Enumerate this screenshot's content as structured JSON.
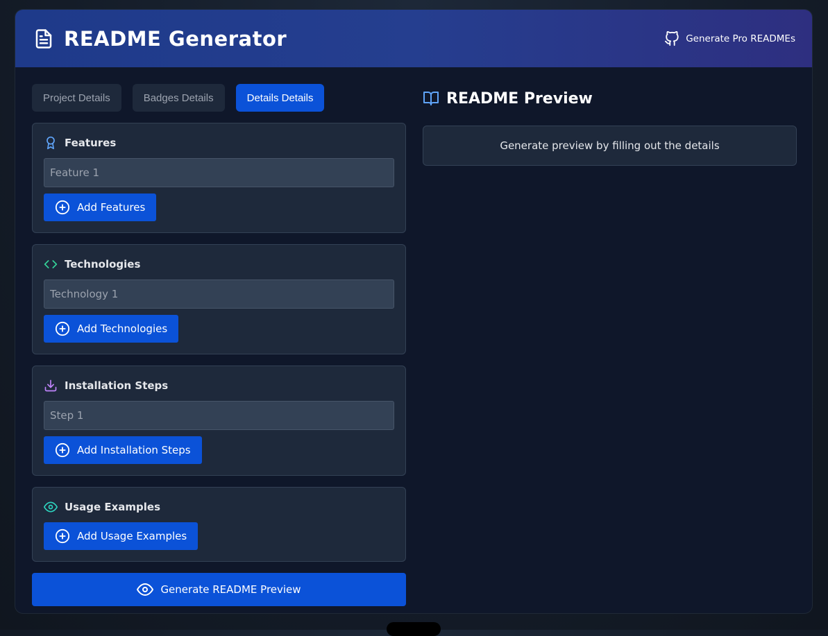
{
  "header": {
    "title": "README Generator",
    "pro_link": "Generate Pro READMEs",
    "icon": "file-text-icon",
    "pro_icon": "github-icon"
  },
  "tabs": [
    {
      "label": "Project Details",
      "active": false
    },
    {
      "label": "Badges Details",
      "active": false
    },
    {
      "label": "Details Details",
      "active": true
    }
  ],
  "sections": {
    "features": {
      "title": "Features",
      "placeholder": "Feature 1",
      "button": "Add Features",
      "icon": "award-icon",
      "icon_color": "#60a5fa"
    },
    "technologies": {
      "title": "Technologies",
      "placeholder": "Technology 1",
      "button": "Add Technologies",
      "icon": "code-icon",
      "icon_color": "#34d399"
    },
    "installation": {
      "title": "Installation Steps",
      "placeholder": "Step 1",
      "button": "Add Installation Steps",
      "icon": "download-icon",
      "icon_color": "#c084fc"
    },
    "usage": {
      "title": "Usage Examples",
      "button": "Add Usage Examples",
      "icon": "eye-icon",
      "icon_color": "#2dd4bf"
    }
  },
  "generate_button": "Generate README Preview",
  "preview": {
    "title": "README Preview",
    "empty_message": "Generate preview by filling out the details",
    "icon": "book-open-icon"
  },
  "colors": {
    "accent": "#0b52d8",
    "panel": "#1e293b",
    "background": "#0f172a"
  }
}
